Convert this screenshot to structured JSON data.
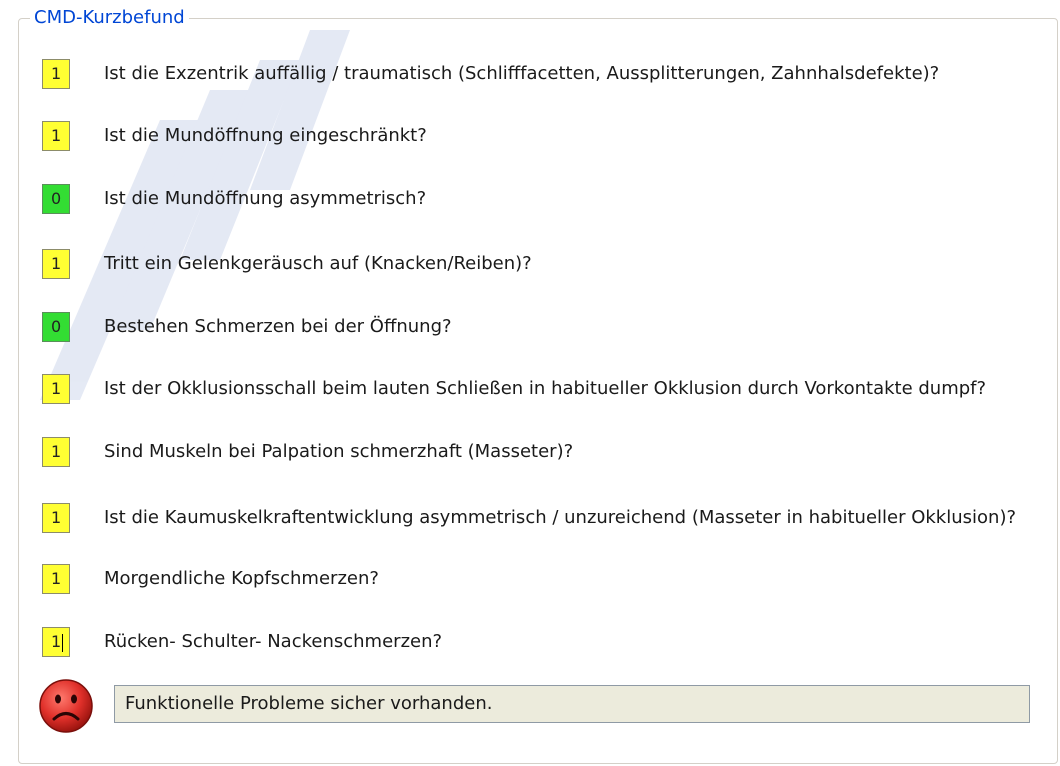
{
  "group_title": "CMD-Kurzbefund",
  "questions": [
    {
      "value": "1",
      "state": "yellow",
      "text": "Ist die Exzentrik auffällig / traumatisch (Schlifffacetten, Aussplitterungen, Zahnhalsdefekte)?"
    },
    {
      "value": "1",
      "state": "yellow",
      "text": "Ist die Mundöffnung eingeschränkt?"
    },
    {
      "value": "0",
      "state": "green",
      "text": "Ist die Mundöffnung asymmetrisch?"
    },
    {
      "value": "1",
      "state": "yellow",
      "text": "Tritt ein Gelenkgeräusch auf (Knacken/Reiben)?"
    },
    {
      "value": "0",
      "state": "green",
      "text": "Bestehen Schmerzen bei der Öffnung?"
    },
    {
      "value": "1",
      "state": "yellow",
      "text": "Ist der Okklusionsschall beim lauten Schließen in habitueller Okklusion durch Vorkontakte dumpf?"
    },
    {
      "value": "1",
      "state": "yellow",
      "text": "Sind Muskeln bei Palpation schmerzhaft (Masseter)?"
    },
    {
      "value": "1",
      "state": "yellow",
      "text": "Ist die Kaumuskelkraftentwicklung asymmetrisch / unzureichend (Masseter in habitueller Okklusion)?"
    },
    {
      "value": "1",
      "state": "yellow",
      "text": "Morgendliche Kopfschmerzen?"
    },
    {
      "value": "1",
      "state": "yellow",
      "text": "Rücken- Schulter- Nackenschmerzen?"
    }
  ],
  "result": {
    "icon": "sad-face-icon",
    "text": "Funktionelle Probleme sicher vorhanden."
  },
  "colors": {
    "yellow": "#ffff33",
    "green": "#33dd33",
    "title": "#0046d5",
    "result_bg": "#ecebdc",
    "smiley": "#e0302a"
  }
}
